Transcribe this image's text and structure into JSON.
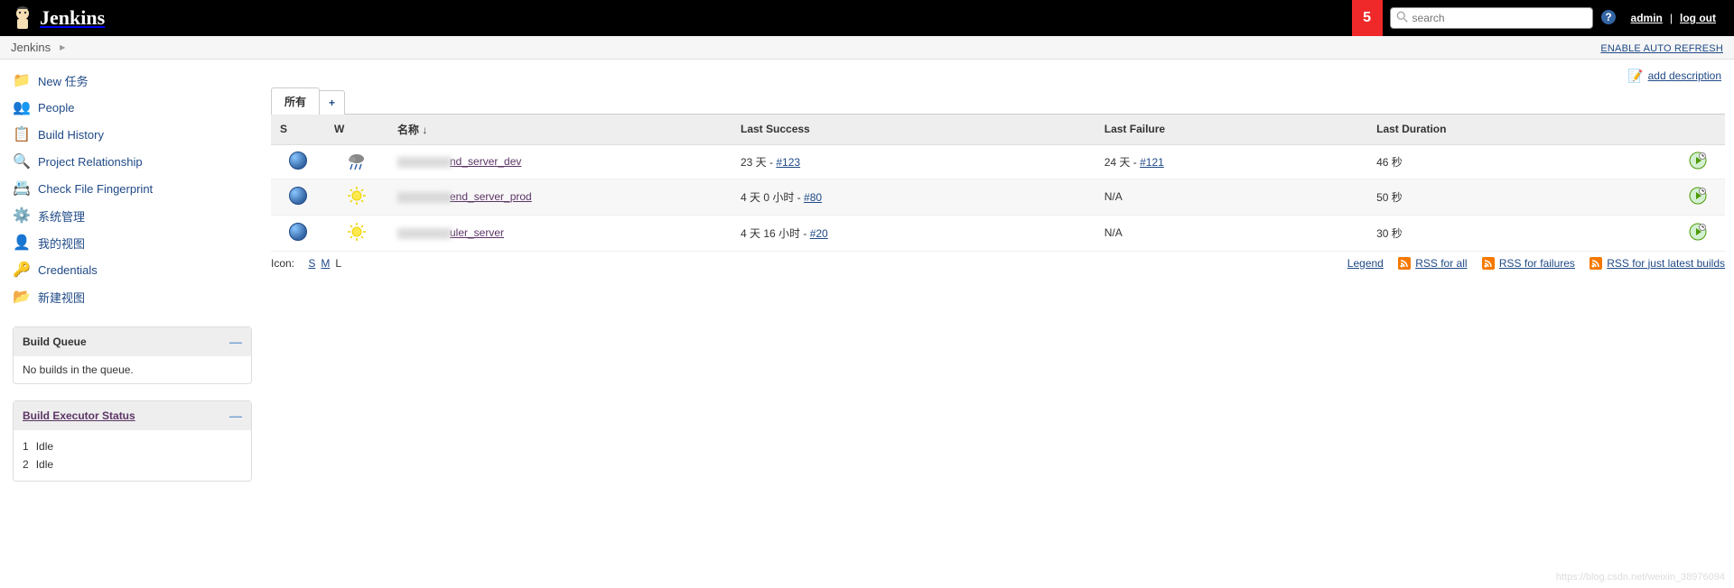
{
  "header": {
    "product": "Jenkins",
    "badge": "5",
    "search_placeholder": "search",
    "user": "admin",
    "logout": "log out"
  },
  "breadcrumb": {
    "root": "Jenkins",
    "auto_refresh": "ENABLE AUTO REFRESH"
  },
  "tasks": [
    {
      "label": "New 任务",
      "icon": "📁",
      "name": "new-item"
    },
    {
      "label": "People",
      "icon": "👥",
      "name": "people"
    },
    {
      "label": "Build History",
      "icon": "📋",
      "name": "build-history"
    },
    {
      "label": "Project Relationship",
      "icon": "🔍",
      "name": "project-relationship"
    },
    {
      "label": "Check File Fingerprint",
      "icon": "📇",
      "name": "fingerprint"
    },
    {
      "label": "系统管理",
      "icon": "⚙️",
      "name": "manage-jenkins"
    },
    {
      "label": "我的视图",
      "icon": "👤",
      "name": "my-views"
    },
    {
      "label": "Credentials",
      "icon": "🔑",
      "name": "credentials"
    },
    {
      "label": "新建视图",
      "icon": "📂",
      "name": "new-view"
    }
  ],
  "queue": {
    "title": "Build Queue",
    "empty": "No builds in the queue."
  },
  "executors": {
    "title": "Build Executor Status",
    "items": [
      {
        "id": "1",
        "state": "Idle"
      },
      {
        "id": "2",
        "state": "Idle"
      }
    ]
  },
  "top_links": {
    "add_description": "add description"
  },
  "tabs": {
    "all": "所有",
    "add": "+"
  },
  "table": {
    "headers": {
      "s": "S",
      "w": "W",
      "name": "名称 ↓",
      "success": "Last Success",
      "failure": "Last Failure",
      "duration": "Last Duration"
    },
    "rows": [
      {
        "name_suffix": "nd_server_dev",
        "success_prefix": "23 天 - ",
        "success_build": "#123",
        "failure_prefix": "24 天 - ",
        "failure_build": "#121",
        "duration": "46 秒",
        "weather": "rain"
      },
      {
        "name_suffix": "end_server_prod",
        "success_prefix": "4 天 0 小时 - ",
        "success_build": "#80",
        "failure_prefix": "",
        "failure_build": "N/A",
        "duration": "50 秒",
        "weather": "sun"
      },
      {
        "name_suffix": "uler_server",
        "success_prefix": "4 天 16 小时 - ",
        "success_build": "#20",
        "failure_prefix": "",
        "failure_build": "N/A",
        "duration": "30 秒",
        "weather": "sun"
      }
    ]
  },
  "footer": {
    "icon_label": "Icon:",
    "sizes": {
      "s": "S",
      "m": "M",
      "l": "L"
    },
    "legend": "Legend",
    "rss_all": "RSS for all",
    "rss_failures": "RSS for failures",
    "rss_latest": "RSS for just latest builds"
  },
  "watermark": "https://blog.csdn.net/weixin_38976094"
}
